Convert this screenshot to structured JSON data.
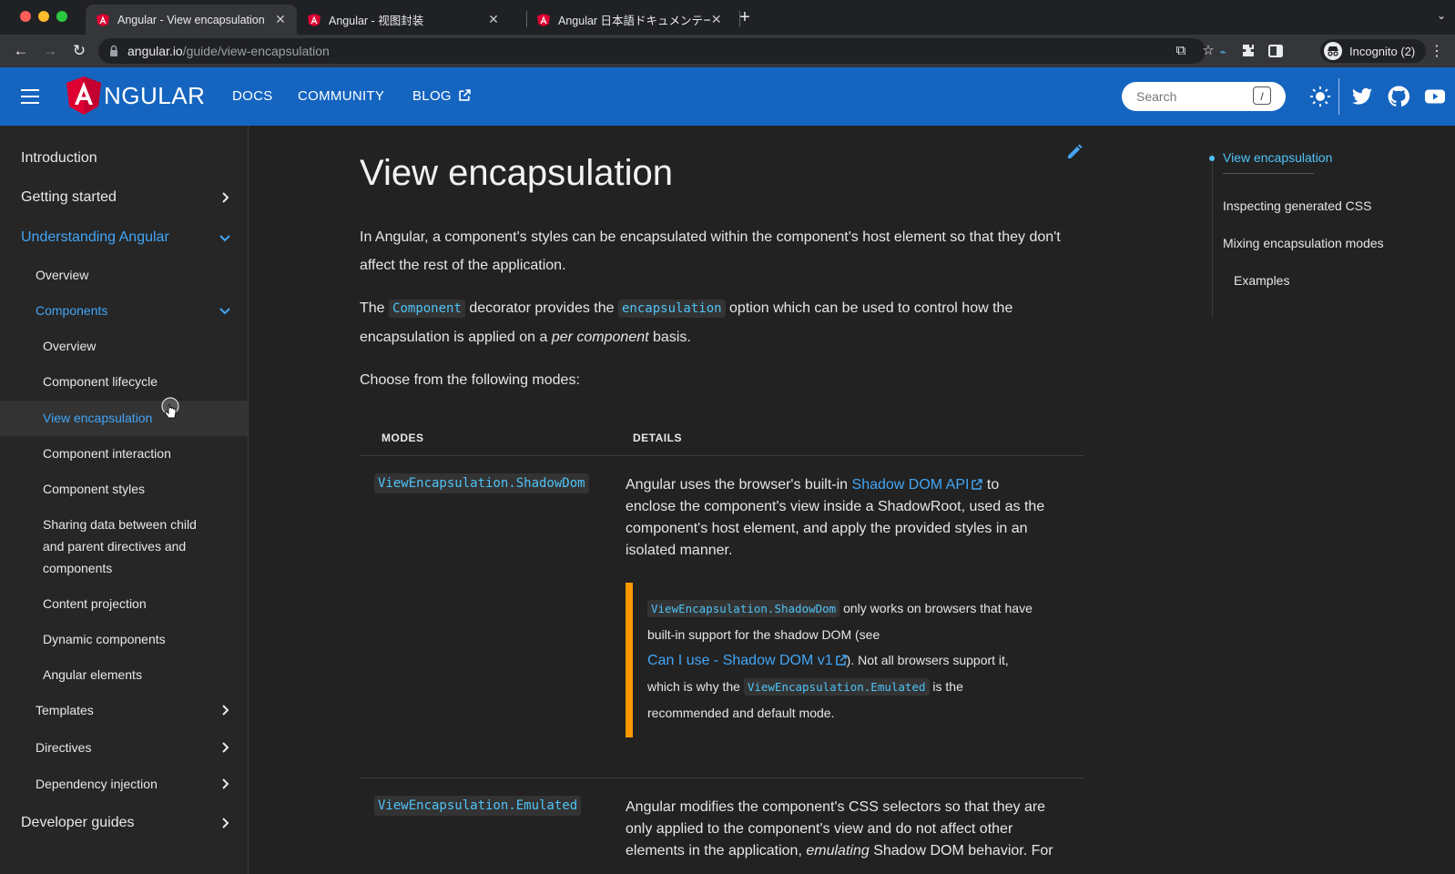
{
  "browser": {
    "tabs": [
      {
        "label": "Angular - View encapsulation",
        "active": true
      },
      {
        "label": "Angular - 视图封装",
        "active": false
      },
      {
        "label": "Angular 日本語ドキュメンテーシ",
        "active": false
      }
    ],
    "url_host": "angular.io",
    "url_path": "/guide/view-encapsulation",
    "profile_label": "Incognito (2)"
  },
  "header": {
    "logo_text": "NGULAR",
    "nav": [
      "DOCS",
      "COMMUNITY",
      "BLOG"
    ],
    "search_placeholder": "Search",
    "search_shortcut": "/"
  },
  "sidebar": {
    "items": [
      {
        "label": "Introduction"
      },
      {
        "label": "Getting started"
      },
      {
        "label": "Understanding Angular"
      },
      {
        "label": "Overview"
      },
      {
        "label": "Components"
      },
      {
        "label": "Overview"
      },
      {
        "label": "Component lifecycle"
      },
      {
        "label": "View encapsulation"
      },
      {
        "label": "Component interaction"
      },
      {
        "label": "Component styles"
      },
      {
        "label": "Sharing data between child"
      },
      {
        "label": "and parent directives and"
      },
      {
        "label": "components"
      },
      {
        "label": "Content projection"
      },
      {
        "label": "Dynamic components"
      },
      {
        "label": "Angular elements"
      },
      {
        "label": "Templates"
      },
      {
        "label": "Directives"
      },
      {
        "label": "Dependency injection"
      },
      {
        "label": "Developer guides"
      }
    ]
  },
  "content": {
    "title": "View encapsulation",
    "p1_line1": "In Angular, a component's styles can be encapsulated within the component's host element so that they don't",
    "p1_line2": "affect the rest of the application.",
    "p2_a": "The",
    "p2_code1": "Component",
    "p2_b": "decorator provides the",
    "p2_code2": "encapsulation",
    "p2_c": "option which can be used to control how the",
    "p2_d": "encapsulation is applied on a",
    "p2_em": "per component",
    "p2_e": "basis.",
    "p3": "Choose from the following modes:",
    "table": {
      "col_modes": "MODES",
      "col_details": "DETAILS",
      "row1_mode": "ViewEncapsulation.ShadowDom",
      "row1_l1_a": "Angular uses the browser's built-in",
      "row1_link": "Shadow DOM API",
      "row1_l1_b": "to",
      "row1_l2": "enclose the component's view inside a ShadowRoot, used as the",
      "row1_l3": "component's host element, and apply the provided styles in an",
      "row1_l4": "isolated manner.",
      "note_code1": "ViewEncapsulation.ShadowDom",
      "note_a": "only works on browsers that have",
      "note_b": "built-in support for the shadow DOM (see",
      "note_link": "Can I use - Shadow DOM v1",
      "note_c": "). Not all browsers support it,",
      "note_d": "which is why the",
      "note_code2": "ViewEncapsulation.Emulated",
      "note_e": "is the",
      "note_f": "recommended and default mode.",
      "row2_mode": "ViewEncapsulation.Emulated",
      "row2_l1": "Angular modifies the component's CSS selectors so that they are",
      "row2_l2": "only applied to the component's view and do not affect other",
      "row2_l3_a": "elements in the application,",
      "row2_l3_em": "emulating",
      "row2_l3_b": "Shadow DOM behavior. For"
    }
  },
  "toc": {
    "items": [
      {
        "label": "View encapsulation"
      },
      {
        "label": "Inspecting generated CSS"
      },
      {
        "label": "Mixing encapsulation modes"
      },
      {
        "label": "Examples"
      }
    ]
  },
  "colors": {
    "header_blue": "#1565c0",
    "link_blue": "#42a5f5",
    "code_cyan": "#4fc3f7",
    "note_orange": "#ff9800"
  }
}
